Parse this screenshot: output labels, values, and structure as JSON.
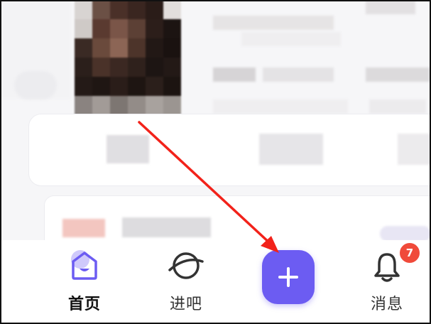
{
  "bottom_nav": {
    "items": [
      {
        "label": "首页",
        "icon": "home-icon",
        "active": true
      },
      {
        "label": "进吧",
        "icon": "planet-icon",
        "active": false
      },
      {
        "label": "",
        "icon": "plus-icon",
        "active": false
      },
      {
        "label": "消息",
        "icon": "bell-icon",
        "active": false
      }
    ],
    "messages_badge": "7"
  },
  "colors": {
    "accent": "#6c5cf2",
    "badge": "#f04a3a",
    "annotation_arrow": "#f2221a"
  }
}
